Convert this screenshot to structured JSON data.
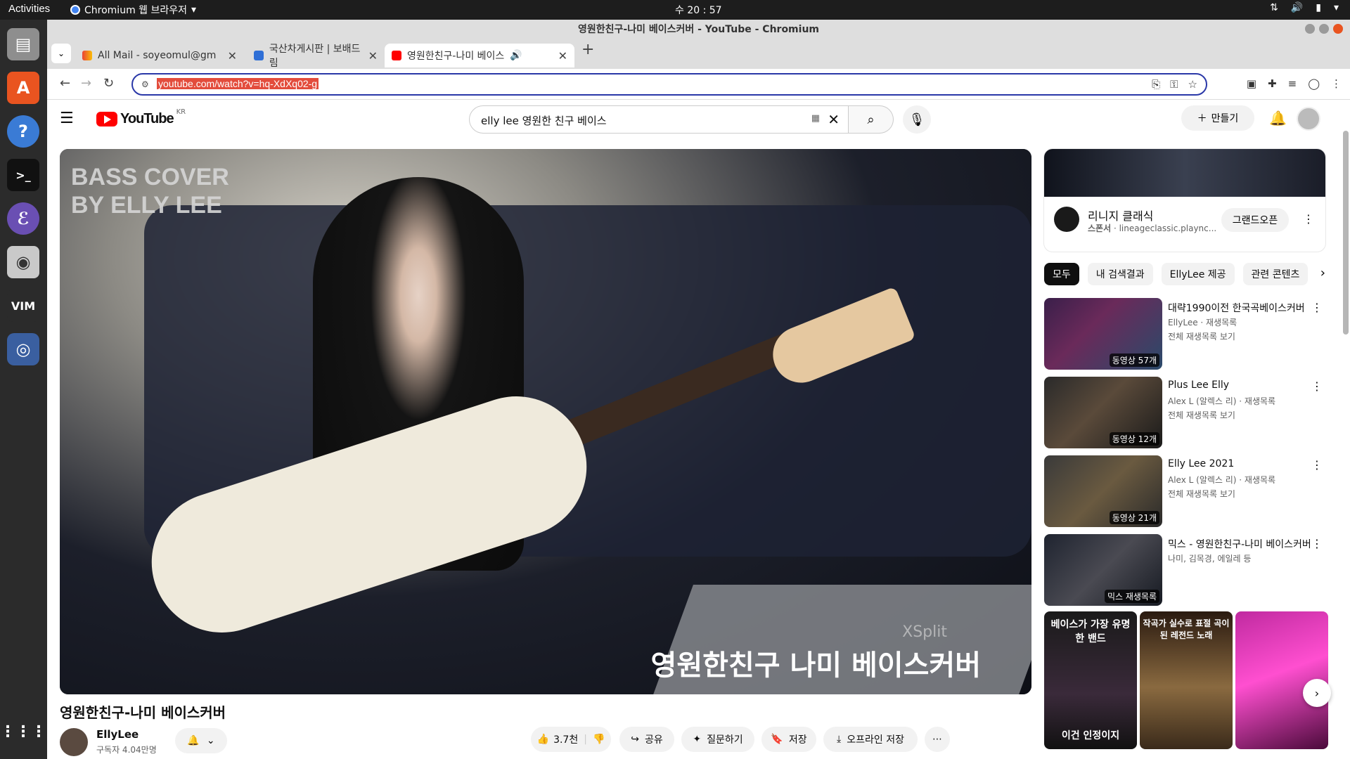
{
  "os": {
    "activities": "Activities",
    "app_name": "Chromium 웹 브라우저",
    "clock": "수 20 : 57"
  },
  "window": {
    "title": "영원한친구-나미 베이스커버 - YouTube - Chromium"
  },
  "tabs": [
    {
      "label": "All Mail - soyeomul@gm",
      "active": false
    },
    {
      "label": "국산차게시판 | 보배드림",
      "active": false
    },
    {
      "label": "영원한친구-나미 베이스",
      "active": true
    }
  ],
  "address": {
    "url": "youtube.com/watch?v=hq-XdXq02-g"
  },
  "youtube": {
    "logo": "YouTube",
    "region": "KR",
    "search_value": "elly lee 영원한 친구 베이스",
    "create_label": "만들기",
    "video": {
      "overlay_top": "BASS COVER\nBY ELLY LEE",
      "overlay_bottom": "영원한친구 나미 베이스커버",
      "watermark": "XSplit",
      "title": "영원한친구-나미 베이스커버"
    },
    "channel": {
      "name": "EllyLee",
      "subscribers": "구독자 4.04만명"
    },
    "actions": {
      "likes": "3.7천",
      "share": "공유",
      "ask": "질문하기",
      "save": "저장",
      "download": "오프라인 저장"
    },
    "ad": {
      "name": "리니지 클래식",
      "sponsor": "스폰서",
      "domain": "lineageclassic.plaync...",
      "button": "그랜드오픈"
    },
    "chips": [
      "모두",
      "내 검색결과",
      "EllyLee 제공",
      "관련 콘텐츠"
    ],
    "recommendations": [
      {
        "title": "대략1990이전 한국곡베이스커버",
        "meta1": "EllyLee · 재생목록",
        "meta2": "전체 재생목록 보기",
        "badge": "동영상 57개"
      },
      {
        "title": "Plus Lee Elly",
        "meta1": "Alex L (알렉스 리) · 재생목록",
        "meta2": "전체 재생목록 보기",
        "badge": "동영상 12개"
      },
      {
        "title": "Elly Lee  2021",
        "meta1": "Alex L (알렉스 리) · 재생목록",
        "meta2": "전체 재생목록 보기",
        "badge": "동영상 21개"
      },
      {
        "title": "믹스 - 영원한친구-나미 베이스커버",
        "meta1": "나미, 김목경, 에일레 등",
        "meta2": "",
        "badge": "믹스 재생목록"
      }
    ],
    "shorts": [
      {
        "caption": "베이스가 가장 유명한 밴드",
        "caption2": "이건 인정이지"
      },
      {
        "caption": "작곡가 실수로 표절 곡이된 레전드 노래",
        "caption2": ""
      },
      {
        "caption": "",
        "caption2": ""
      }
    ]
  },
  "colors": {
    "accent": "#ff0000",
    "url_highlight": "#e34c3c",
    "omnibox_border": "#2a38a8"
  }
}
